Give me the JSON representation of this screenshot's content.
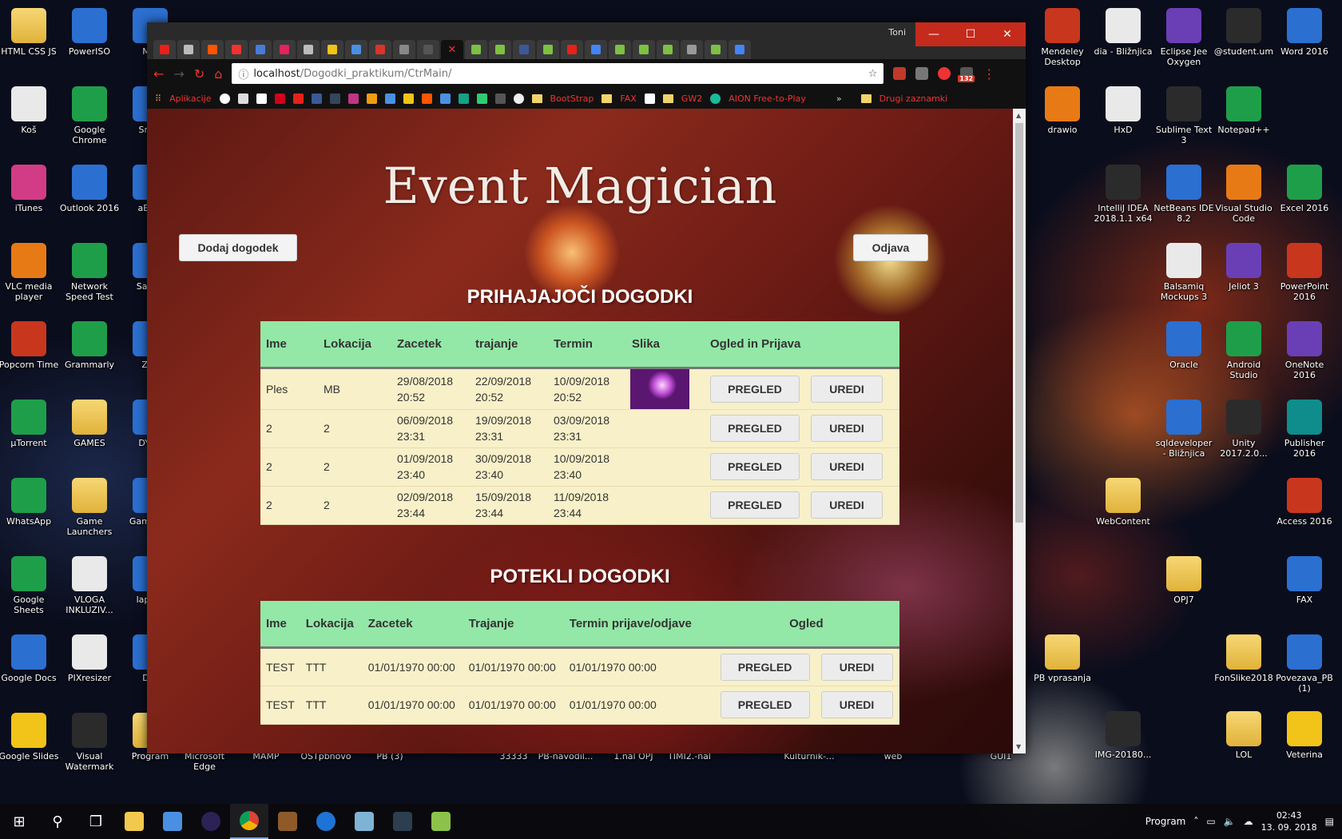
{
  "desktop": {
    "left_icons": [
      {
        "label": "HTML CSS JS",
        "icon": "folder-icon"
      },
      {
        "label": "PowerISO",
        "icon": "poweriso-icon"
      },
      {
        "label": "MSi",
        "icon": "msi-icon"
      },
      {
        "label": "Koš",
        "icon": "recycle-bin-icon"
      },
      {
        "label": "Google Chrome",
        "icon": "chrome-icon"
      },
      {
        "label": "Smar",
        "icon": "app-icon"
      },
      {
        "label": "iTunes",
        "icon": "itunes-icon"
      },
      {
        "label": "Outlook 2016",
        "icon": "outlook-icon"
      },
      {
        "label": "aExm",
        "icon": "app-icon"
      },
      {
        "label": "VLC media player",
        "icon": "vlc-icon"
      },
      {
        "label": "Network Speed Test",
        "icon": "network-icon"
      },
      {
        "label": "San Ki",
        "icon": "app-icon"
      },
      {
        "label": "Popcorn Time",
        "icon": "popcorn-icon"
      },
      {
        "label": "Grammarly",
        "icon": "grammarly-icon"
      },
      {
        "label": "Zab",
        "icon": "app-icon"
      },
      {
        "label": "µTorrent",
        "icon": "utorrent-icon"
      },
      {
        "label": "GAMES",
        "icon": "folder-icon"
      },
      {
        "label": "DYbC",
        "icon": "app-icon"
      },
      {
        "label": "WhatsApp",
        "icon": "whatsapp-icon"
      },
      {
        "label": "Game Launchers",
        "icon": "folder-icon"
      },
      {
        "label": "Game My",
        "icon": "app-icon"
      },
      {
        "label": "Google Sheets",
        "icon": "sheets-icon"
      },
      {
        "label": "VLOGA INKLUZIV...",
        "icon": "pdf-icon"
      },
      {
        "label": "laptop",
        "icon": "app-icon"
      },
      {
        "label": "Google Docs",
        "icon": "docs-icon"
      },
      {
        "label": "PIXresizer",
        "icon": "pixresizer-icon"
      },
      {
        "label": "Dro",
        "icon": "app-icon"
      },
      {
        "label": "Google Slides",
        "icon": "slides-icon"
      },
      {
        "label": "Visual Watermark",
        "icon": "watermark-icon"
      },
      {
        "label": "Program",
        "icon": "folder-icon"
      }
    ],
    "bottom_labels": [
      "Microsoft Edge",
      "MAMP",
      "OSTpbnovo",
      "PB (3)",
      "33333",
      "PB-navodil...",
      "1.nal OPJ",
      "TIMI2.-nal",
      "Kulturnik-...",
      "web",
      "GUI1"
    ],
    "right_icons": [
      {
        "label": "Mendeley Desktop",
        "icon": "mendeley-icon"
      },
      {
        "label": "dia - Bližnjica",
        "icon": "dia-icon"
      },
      {
        "label": "Eclipse Jee Oxygen",
        "icon": "eclipse-icon"
      },
      {
        "label": "@student.um",
        "icon": "student-icon"
      },
      {
        "label": "Word 2016",
        "icon": "word-icon"
      },
      {
        "label": "drawio",
        "icon": "drawio-icon"
      },
      {
        "label": "HxD",
        "icon": "hxd-icon"
      },
      {
        "label": "Sublime Text 3",
        "icon": "sublime-icon"
      },
      {
        "label": "Notepad++",
        "icon": "notepad-icon"
      },
      {
        "label": "IntelliJ IDEA 2018.1.1 x64",
        "icon": "intellij-icon"
      },
      {
        "label": "NetBeans IDE 8.2",
        "icon": "netbeans-icon"
      },
      {
        "label": "Visual Studio Code",
        "icon": "vscode-icon"
      },
      {
        "label": "Excel 2016",
        "icon": "excel-icon"
      },
      {
        "label": "Balsamiq Mockups 3",
        "icon": "balsamiq-icon"
      },
      {
        "label": "Jeliot 3",
        "icon": "jeliot-icon"
      },
      {
        "label": "PowerPoint 2016",
        "icon": "powerpoint-icon"
      },
      {
        "label": "Oracle",
        "icon": "oracle-icon"
      },
      {
        "label": "Android Studio",
        "icon": "android-icon"
      },
      {
        "label": "OneNote 2016",
        "icon": "onenote-icon"
      },
      {
        "label": "sqldeveloper - Bližnjica",
        "icon": "sqldeveloper-icon"
      },
      {
        "label": "Unity 2017.2.0...",
        "icon": "unity-icon"
      },
      {
        "label": "Publisher 2016",
        "icon": "publisher-icon"
      },
      {
        "label": "WebContent",
        "icon": "folder-icon"
      },
      {
        "label": "Access 2016",
        "icon": "access-icon"
      },
      {
        "label": "OPJ7",
        "icon": "folder-icon"
      },
      {
        "label": "FAX",
        "icon": "fax-icon"
      },
      {
        "label": "PB vprasanja",
        "icon": "folder-icon"
      },
      {
        "label": "FonSlike2018",
        "icon": "folder-icon"
      },
      {
        "label": "Povezava_PB (1)",
        "icon": "shortcut-icon"
      },
      {
        "label": "IMG-20180...",
        "icon": "image-icon"
      },
      {
        "label": "LOL",
        "icon": "folder-icon"
      },
      {
        "label": "Veterina",
        "icon": "star-icon"
      }
    ]
  },
  "browser": {
    "profile_name": "Toni",
    "url_host": "localhost",
    "url_path": "/Dogodki_praktikum/CtrMain/",
    "bookmarks": [
      "Aplikacije",
      "BootStrap",
      "FAX",
      "GW2",
      "AION Free-to-Play",
      "»",
      "Drugi zaznamki"
    ],
    "badge_count": "132"
  },
  "page": {
    "title": "Event Magician",
    "add_event_button": "Dodaj dogodek",
    "logout_button": "Odjava",
    "upcoming": {
      "heading": "PRIHAJAJOČI DOGODKI",
      "columns": [
        "Ime",
        "Lokacija",
        "Zacetek",
        "trajanje",
        "Termin",
        "Slika",
        "Ogled in Prijava"
      ],
      "rows": [
        {
          "ime": "Ples",
          "lokacija": "MB",
          "zacetek_date": "29/08/2018",
          "zacetek_time": "20:52",
          "trajanje_date": "22/09/2018",
          "trajanje_time": "20:52",
          "termin_date": "10/09/2018",
          "termin_time": "20:52",
          "has_image": true
        },
        {
          "ime": "2",
          "lokacija": "2",
          "zacetek_date": "06/09/2018",
          "zacetek_time": "23:31",
          "trajanje_date": "19/09/2018",
          "trajanje_time": "23:31",
          "termin_date": "03/09/2018",
          "termin_time": "23:31",
          "has_image": false
        },
        {
          "ime": "2",
          "lokacija": "2",
          "zacetek_date": "01/09/2018",
          "zacetek_time": "23:40",
          "trajanje_date": "30/09/2018",
          "trajanje_time": "23:40",
          "termin_date": "10/09/2018",
          "termin_time": "23:40",
          "has_image": false
        },
        {
          "ime": "2",
          "lokacija": "2",
          "zacetek_date": "02/09/2018",
          "zacetek_time": "23:44",
          "trajanje_date": "15/09/2018",
          "trajanje_time": "23:44",
          "termin_date": "11/09/2018",
          "termin_time": "23:44",
          "has_image": false
        }
      ],
      "view_label": "PREGLED",
      "edit_label": "UREDI"
    },
    "past": {
      "heading": "POTEKLI DOGODKI",
      "columns": [
        "Ime",
        "Lokacija",
        "Zacetek",
        "Trajanje",
        "Termin prijave/odjave",
        "Ogled"
      ],
      "rows": [
        {
          "ime": "TEST",
          "lokacija": "TTT",
          "zacetek": "01/01/1970 00:00",
          "trajanje": "01/01/1970 00:00",
          "termin": "01/01/1970 00:00"
        },
        {
          "ime": "TEST",
          "lokacija": "TTT",
          "zacetek": "01/01/1970 00:00",
          "trajanje": "01/01/1970 00:00",
          "termin": "01/01/1970 00:00"
        }
      ],
      "view_label": "PREGLED",
      "edit_label": "UREDI"
    }
  },
  "taskbar": {
    "tray_label": "Program",
    "time": "02:43",
    "date": "13. 09. 2018"
  }
}
